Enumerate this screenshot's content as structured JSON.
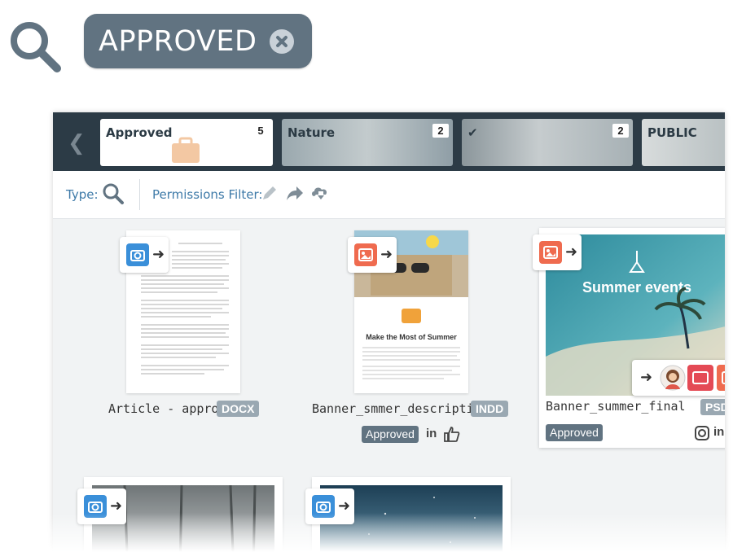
{
  "search_chip": {
    "label": "APPROVED",
    "icon": "search-icon",
    "clear_icon": "close-circle-icon"
  },
  "collections": [
    {
      "label": "Approved",
      "count": "5"
    },
    {
      "label": "Nature",
      "count": "2"
    },
    {
      "label": "✔",
      "count": "2"
    },
    {
      "label": "PUBLIC",
      "count": ""
    }
  ],
  "filters": {
    "type_label": "Type:",
    "permissions_label": "Permissions Filter:"
  },
  "assets": [
    {
      "name": "Article - approved",
      "ext": "DOCX",
      "status": ""
    },
    {
      "name": "Banner_smmer_descriptio...",
      "ext": "INDD",
      "status": "Approved",
      "thumb_heading": "Make the Most of Summer"
    },
    {
      "name": "Banner_summer_final",
      "ext": "PSD",
      "status": "Approved",
      "thumb_heading": "Summer events"
    }
  ],
  "colors": {
    "chip": "#617381",
    "tabbar": "#2c3b46",
    "accent_blue": "#3e7aa8",
    "badge_blue": "#3a8fd9",
    "badge_red": "#ef6b4f"
  }
}
